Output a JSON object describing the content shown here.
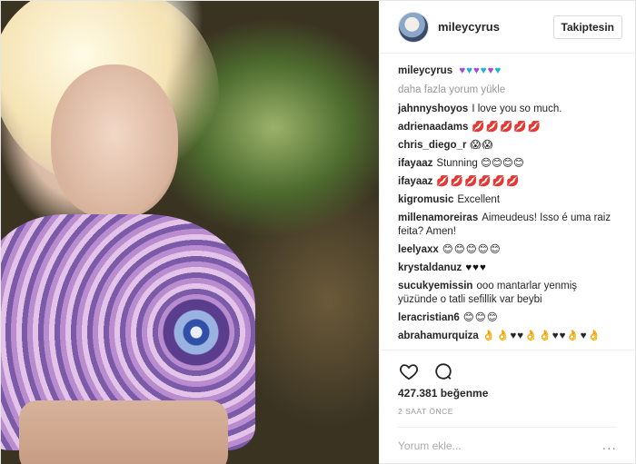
{
  "header": {
    "username": "mileycyrus",
    "follow_label": "Takiptesin"
  },
  "caption": {
    "username": "mileycyrus",
    "hearts": [
      {
        "glyph": "♥",
        "color": "purple"
      },
      {
        "glyph": "♥",
        "color": "blue"
      },
      {
        "glyph": "♥",
        "color": "purple"
      },
      {
        "glyph": "♥",
        "color": "blue"
      },
      {
        "glyph": "♥",
        "color": "purple"
      },
      {
        "glyph": "♥",
        "color": "blue"
      }
    ]
  },
  "load_more": "daha fazla yorum yükle",
  "comments": [
    {
      "user": "jahnnyshoyos",
      "text": "I love you so much."
    },
    {
      "user": "adrienaadams",
      "text": "💋💋💋💋💋"
    },
    {
      "user": "chris_diego_r",
      "text": "😱😱"
    },
    {
      "user": "ifayaaz",
      "text": "Stunning 😊😊😊😊"
    },
    {
      "user": "ifayaaz",
      "text": "💋💋💋💋💋💋"
    },
    {
      "user": "kigromusic",
      "text": "Excellent"
    },
    {
      "user": "millenamoreiras",
      "text": "Aimeudeus! Isso é uma raiz feita? Amen!"
    },
    {
      "user": "leelyaxx",
      "text": "😊😊😊😊😊"
    },
    {
      "user": "krystaldanuz",
      "text": "♥♥♥"
    },
    {
      "user": "sucukyemissin",
      "text": "ooo mantarlar yenmiş yüzünde o tatli sefillik var beybi"
    },
    {
      "user": "leracristian6",
      "text": "😊😊😊"
    },
    {
      "user": "abrahamurquiza",
      "text": "👌👌♥♥👌👌♥♥👌♥👌"
    }
  ],
  "actions": {
    "like_icon": "heart-outline-icon",
    "comment_icon": "speech-bubble-icon"
  },
  "likes": "427.381 beğenme",
  "time": "2 SAAT ÖNCE",
  "add_comment": {
    "placeholder": "Yorum ekle...",
    "more": "..."
  },
  "colors": {
    "text": "#262626",
    "muted": "#999999",
    "border": "#efefef"
  }
}
